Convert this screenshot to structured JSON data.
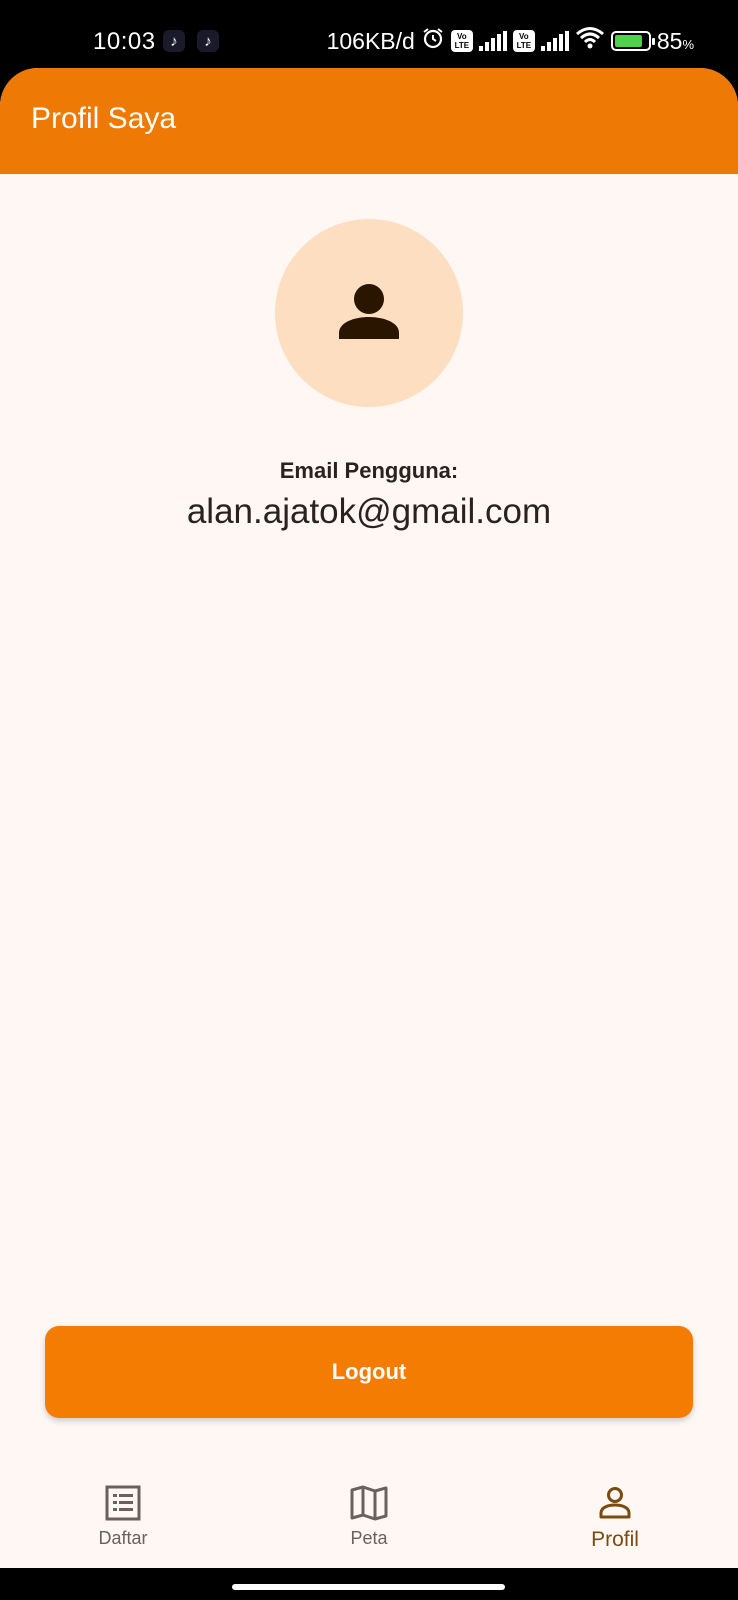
{
  "status_bar": {
    "time": "10:03",
    "notification_icons": [
      "tiktok-icon",
      "tiktok-icon"
    ],
    "network_speed": "106KB/d",
    "battery_percent": "85",
    "battery_unit": "%",
    "battery_level": 0.85,
    "battery_color": "#4cd34a"
  },
  "app_bar": {
    "title": "Profil Saya",
    "color": "#ee7905"
  },
  "profile": {
    "avatar_icon": "person-icon",
    "email_label": "Email Pengguna:",
    "email_value": "alan.ajatok@gmail.com"
  },
  "logout": {
    "label": "Logout",
    "color": "#f47c02"
  },
  "bottom_nav": {
    "items": [
      {
        "label": "Daftar",
        "icon": "list-icon",
        "active": false
      },
      {
        "label": "Peta",
        "icon": "map-icon",
        "active": false
      },
      {
        "label": "Profil",
        "icon": "person-icon",
        "active": true
      }
    ]
  }
}
